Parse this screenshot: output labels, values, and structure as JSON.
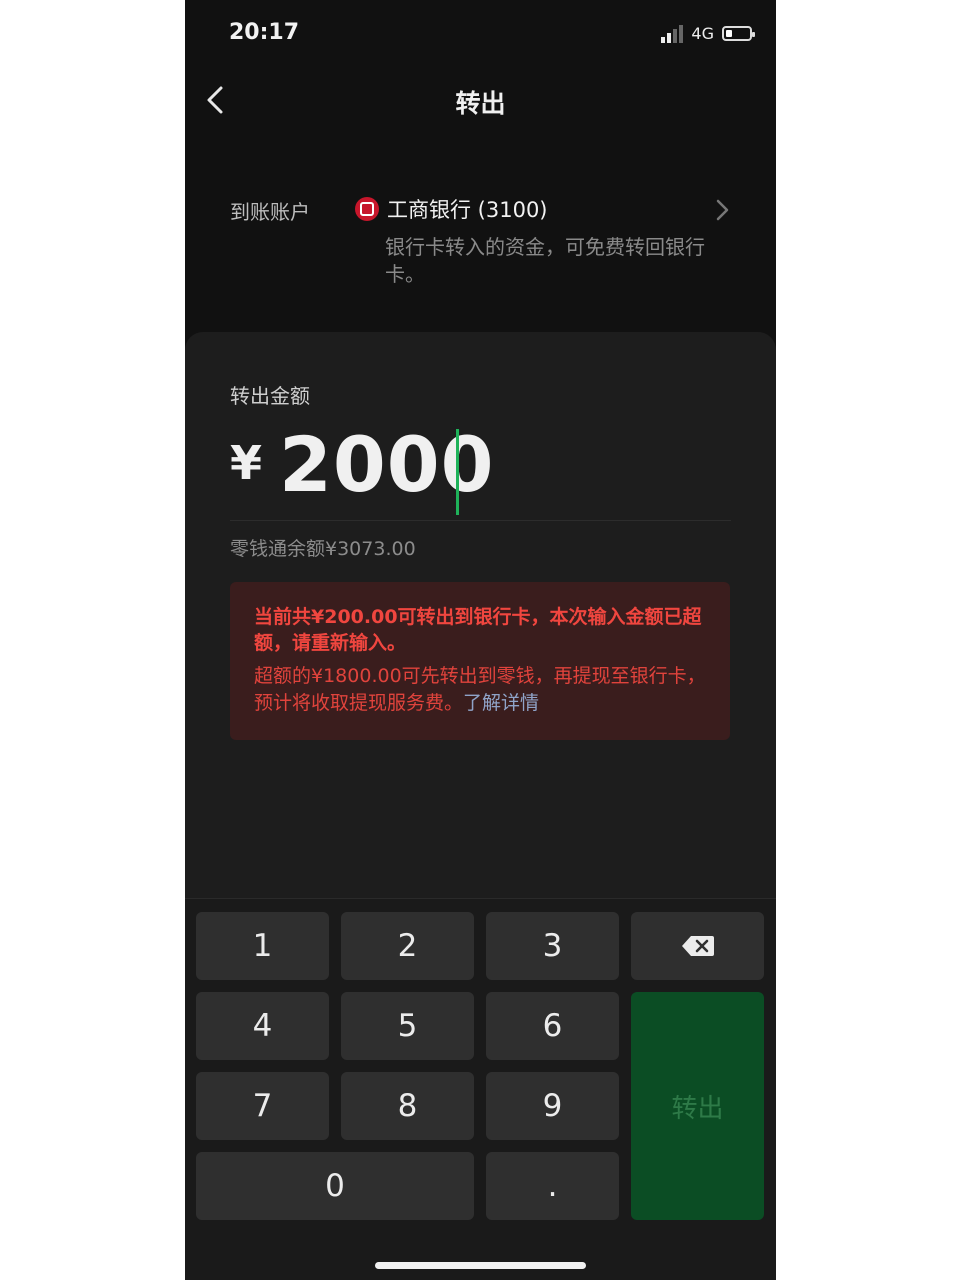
{
  "status_bar": {
    "time": "20:17",
    "network": "4G",
    "battery_level": 0.25
  },
  "nav": {
    "title": "转出"
  },
  "account": {
    "label": "到账账户",
    "bank_name": "工商银行 (3100)",
    "note": "银行卡转入的资金，可免费转回银行卡。"
  },
  "amount": {
    "label": "转出金额",
    "currency_symbol": "¥",
    "value": "2000",
    "balance_text": "零钱通余额¥3073.00"
  },
  "warning": {
    "main": "当前共¥200.00可转出到银行卡，本次输入金额已超额，请重新输入。",
    "sub": "超额的¥1800.00可先转出到零钱，再提现至银行卡，预计将收取提现服务费。",
    "link": "了解详情"
  },
  "keypad": {
    "keys": [
      "1",
      "2",
      "3",
      "4",
      "5",
      "6",
      "7",
      "8",
      "9",
      "0",
      "."
    ],
    "submit_label": "转出"
  },
  "colors": {
    "background": "#111111",
    "card": "#1d1d1d",
    "warning_bg": "#3a1d1d",
    "warning_text": "#f0463f",
    "link": "#8fa3c8",
    "cursor": "#1fb25a",
    "submit_bg": "#0b4d24",
    "key_bg": "#2f2f2f"
  },
  "icons": {
    "back": "chevron-left-icon",
    "account_chevron": "chevron-right-icon",
    "bank_logo": "icbc-logo-icon",
    "backspace": "backspace-icon",
    "signal": "signal-icon",
    "battery": "battery-icon"
  }
}
